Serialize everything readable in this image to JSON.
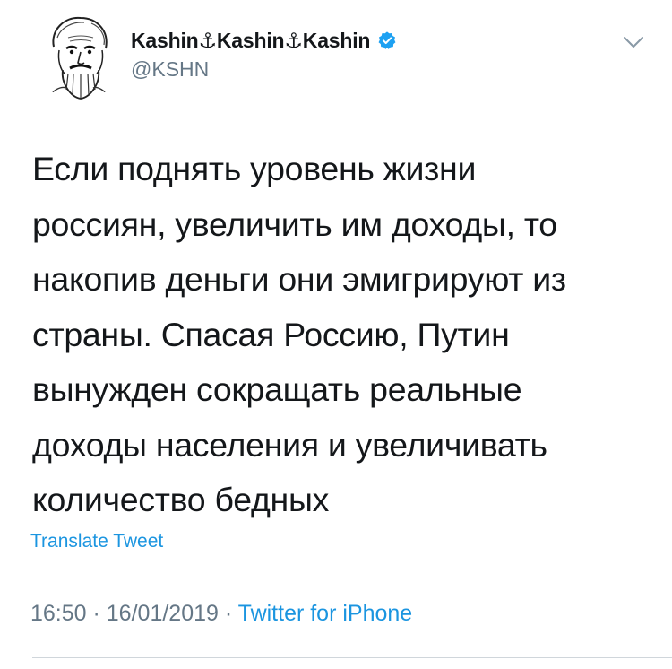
{
  "author": {
    "display_name": "Kashin⚓Kashin⚓Kashin",
    "handle": "@KSHN",
    "verified": true,
    "avatar_icon": "bearded-man-sketch-avatar"
  },
  "tweet": {
    "text": "Если поднять уровень жизни\nроссиян, увеличить им доходы, то\nнакопив деньги они эмигрируют из\nстраны. Спасая Россию, Путин\nвынужден сокращать реальные\nдоходы населения и увеличивать\nколичество бедных",
    "translate_label": "Translate Tweet",
    "time": "16:50",
    "separator1": " · ",
    "date": "16/01/2019",
    "separator2": " · ",
    "source": "Twitter for iPhone"
  },
  "icons": {
    "verified": "verified-badge-icon",
    "menu": "chevron-down-icon"
  },
  "colors": {
    "text": "#14171a",
    "secondary": "#657786",
    "accent": "#1b95e0",
    "verified": "#1da1f2"
  }
}
